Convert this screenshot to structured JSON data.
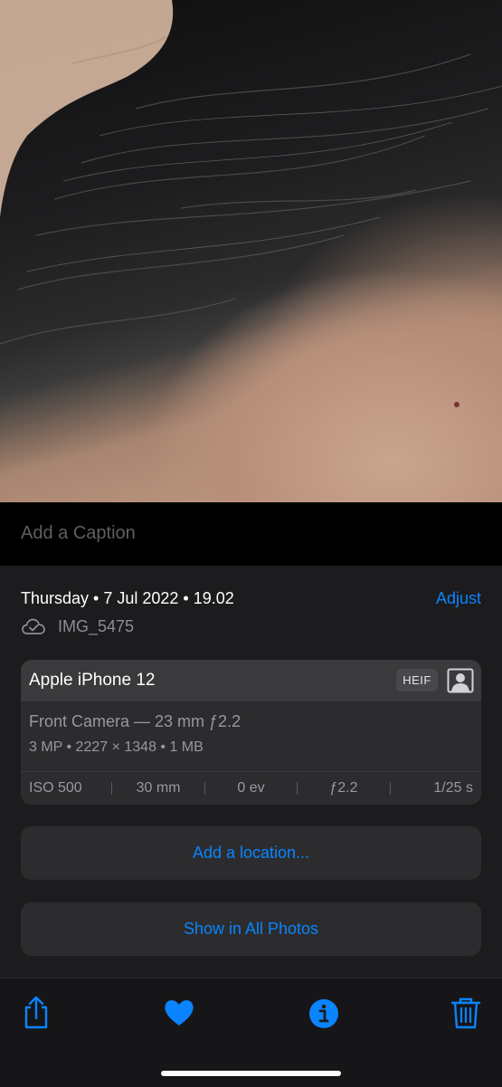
{
  "photo": {
    "icon": "photo-subject"
  },
  "caption": {
    "placeholder": "Add a Caption"
  },
  "header": {
    "date": "Thursday • 7 Jul 2022 • 19.02",
    "adjust_label": "Adjust",
    "filename": "IMG_5475",
    "cloud_icon": "icloud-check-icon"
  },
  "device_card": {
    "device": "Apple iPhone 12",
    "format_badge": "HEIF",
    "lens": "Front Camera — 23 mm ƒ2.2",
    "specs": "3 MP  •  2227 × 1348  •  1 MB",
    "exif": [
      "ISO 500",
      "30 mm",
      "0 ev",
      "ƒ2.2",
      "1/25 s"
    ]
  },
  "actions": {
    "add_location": "Add a location...",
    "show_all": "Show in All Photos"
  },
  "toolbar": {
    "icons": [
      "share-icon",
      "heart-icon",
      "info-icon",
      "trash-icon"
    ],
    "accent": "#0a84ff"
  }
}
